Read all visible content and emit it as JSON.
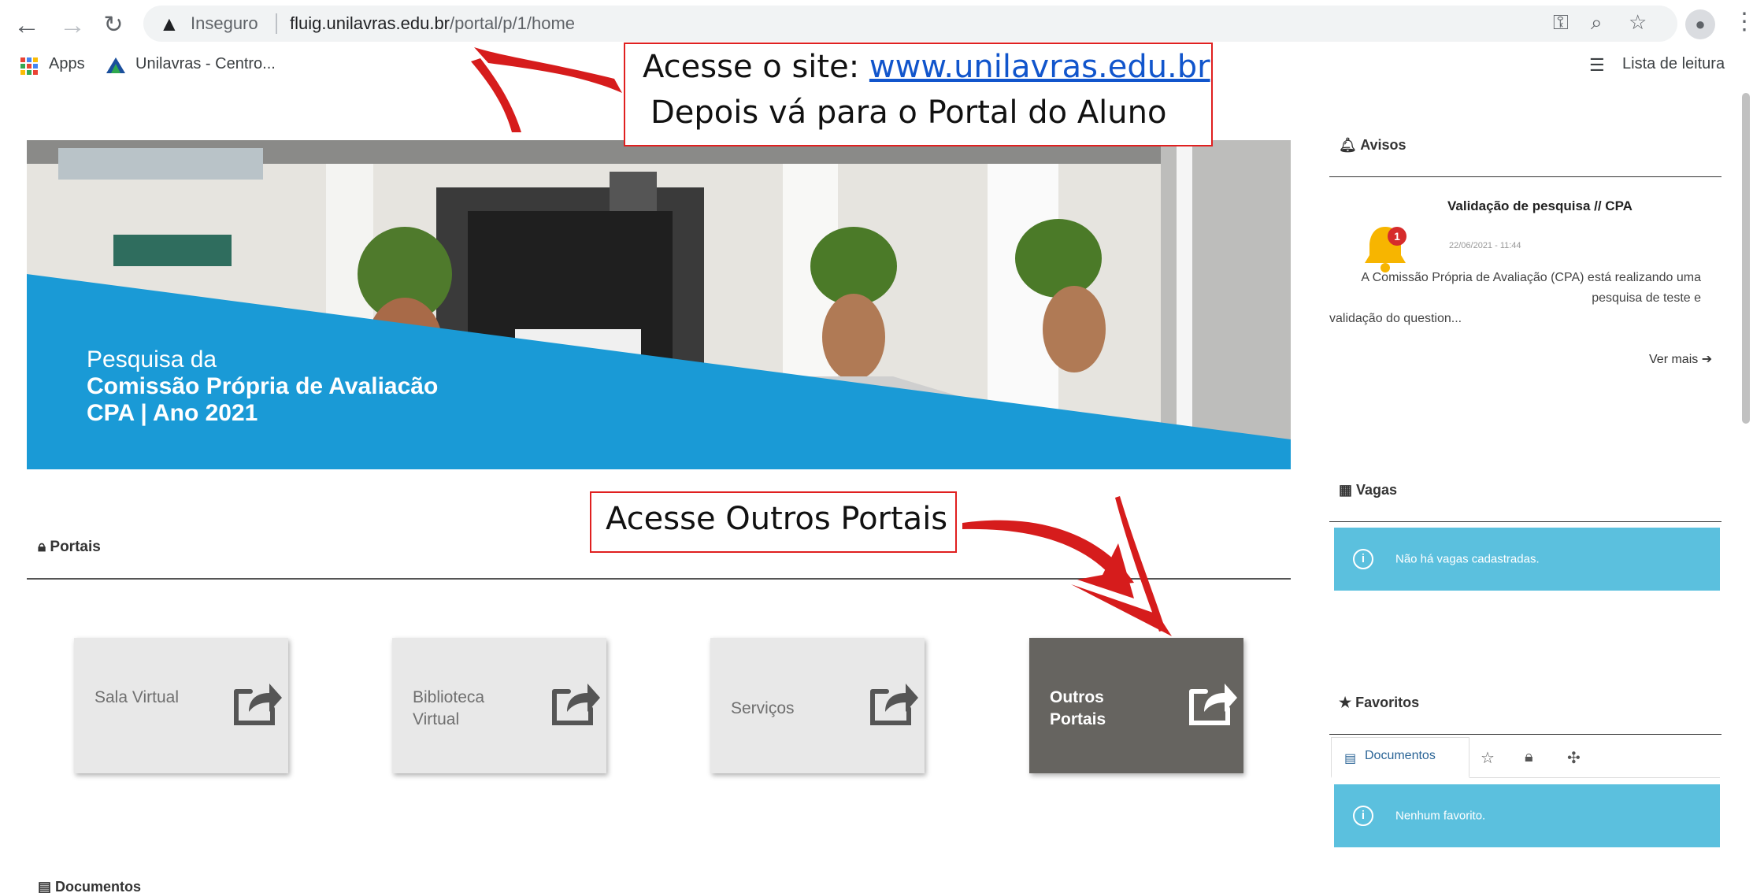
{
  "browser": {
    "security_label": "Inseguro",
    "url_host": "fluig.unilavras.edu.br",
    "url_path": "/portal/p/1/home",
    "bookmarks": [
      {
        "label": "Apps",
        "icon": "apps-grid-icon"
      },
      {
        "label": "Unilavras - Centro...",
        "icon": "unilavras-logo-icon"
      }
    ],
    "reading_list": "Lista de leitura"
  },
  "banner": {
    "line1": "Pesquisa da",
    "line2": "Comissão Própria de Avaliacão",
    "line3": "CPA | Ano 2021"
  },
  "portals": {
    "title": "Portais",
    "cards": [
      {
        "label": "Sala Virtual",
        "highlighted": false
      },
      {
        "label": "Biblioteca Virtual",
        "highlighted": false
      },
      {
        "label": "Serviços",
        "highlighted": false
      },
      {
        "label": "Outros Portais",
        "highlighted": true
      }
    ]
  },
  "documents": {
    "title": "Documentos"
  },
  "sidebar": {
    "avisos": {
      "title": "Avisos",
      "item_title": "Validação de pesquisa // CPA",
      "item_date": "22/06/2021 - 11:44",
      "item_body": "A Comissão Própria de Avaliação (CPA) está realizando uma pesquisa de teste e",
      "item_body_tail": "validação do question...",
      "badge_count": "1",
      "more": "Ver mais"
    },
    "vagas": {
      "title": "Vagas",
      "empty": "Não há vagas cadastradas."
    },
    "favoritos": {
      "title": "Favoritos",
      "tab_documents": "Documentos",
      "empty": "Nenhum favorito."
    }
  },
  "annotations": {
    "callout1_prefix": "Acesse o site: ",
    "callout1_link": "www.unilavras.edu.br",
    "callout1_line2": "Depois vá para o Portal do Aluno",
    "callout2": "Acesse Outros Portais"
  },
  "colors": {
    "accent_blue": "#1a9ad6",
    "info_box": "#5bc0de",
    "highlight_card": "#666460",
    "annotation_red": "#e02020"
  }
}
